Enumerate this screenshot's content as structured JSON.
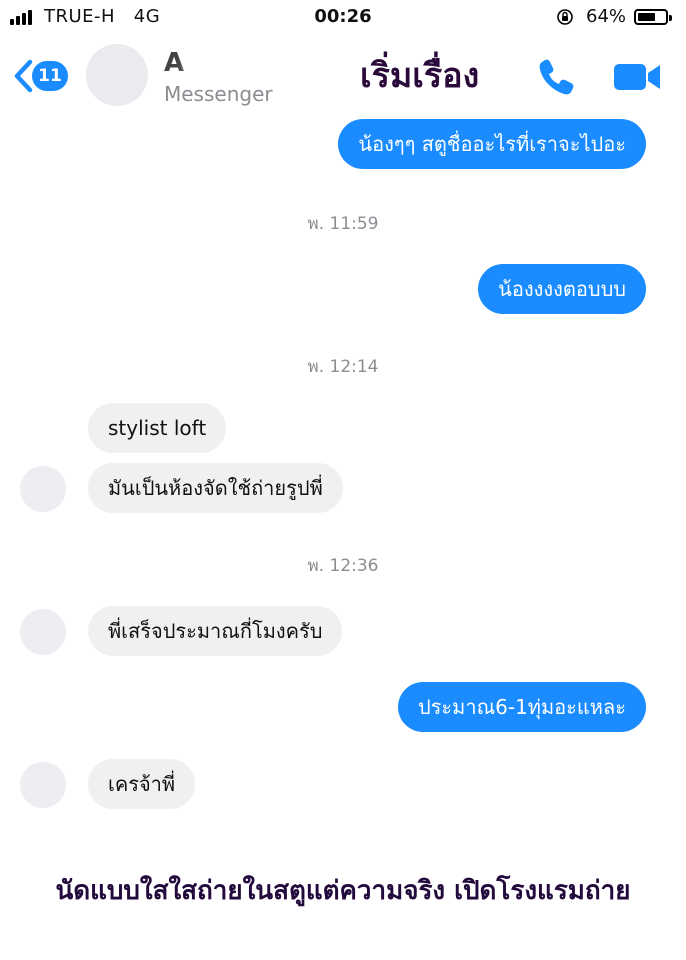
{
  "status_bar": {
    "carrier": "TRUE-H",
    "network": "4G",
    "time": "00:26",
    "battery_percent": "64%",
    "battery_level": 0.64
  },
  "header": {
    "back_badge": "11",
    "contact_name": "A",
    "subtitle": "Messenger",
    "overlay_title": "เริ่มเรื่อง",
    "accent_color": "#1a8cff"
  },
  "messages": [
    {
      "type": "outgoing",
      "text": "น้องๆๆ สตูชื่ออะไรที่เราจะไปอะ"
    },
    {
      "type": "timestamp",
      "text": "พ. 11:59"
    },
    {
      "type": "outgoing",
      "text": "น้องงงงตอบบบ"
    },
    {
      "type": "timestamp",
      "text": "พ. 12:14"
    },
    {
      "type": "incoming",
      "text": "stylist loft"
    },
    {
      "type": "incoming",
      "text": "มันเป็นห้องจัดใช้ถ่ายรูปพี่"
    },
    {
      "type": "timestamp",
      "text": "พ. 12:36"
    },
    {
      "type": "incoming",
      "text": "พี่เสร็จประมาณกี่โมงครับ"
    },
    {
      "type": "outgoing",
      "text": "ประมาณ6-1ทุ่มอะแหละ"
    },
    {
      "type": "incoming",
      "text": "เครจ้าพี่"
    }
  ],
  "caption": "นัดแบบใสใสถ่ายในสตูแต่ความจริง เปิดโรงแรมถ่าย"
}
